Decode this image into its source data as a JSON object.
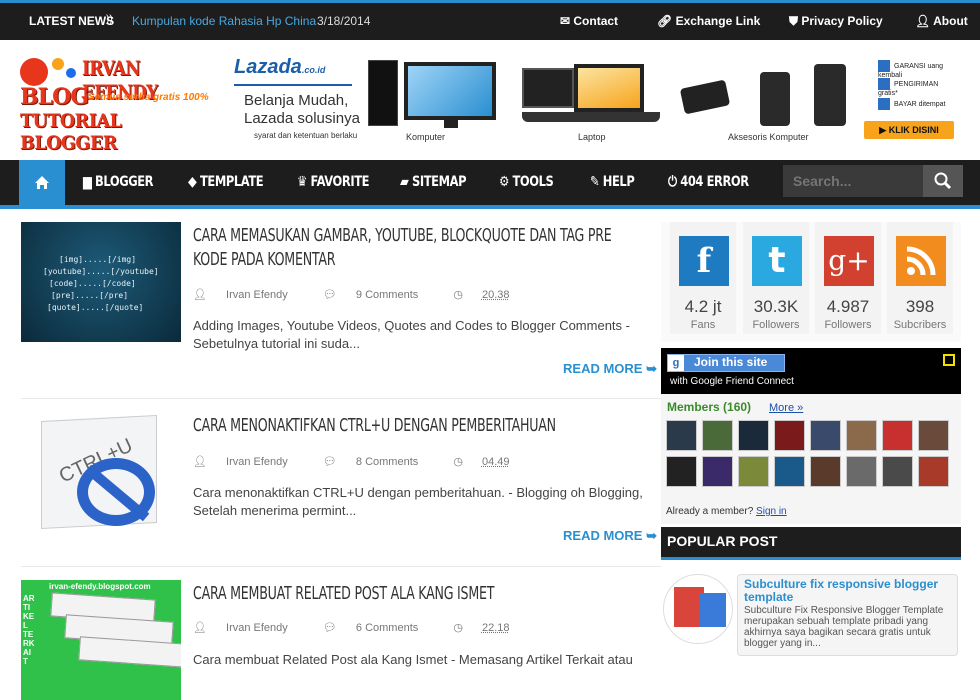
{
  "topbar": {
    "news_label": "LATEST NEWS",
    "news_link": "Kumpulan kode Rahasia Hp China",
    "news_date": "3/18/2014",
    "links": [
      "Contact",
      "Exchange Link",
      "Privacy Policy",
      "About"
    ]
  },
  "header": {
    "logo_line1": "IRVAN EFENDY",
    "logo_line2": "BLOG",
    "logo_tagline": "Semua serba gratis 100%",
    "logo_line3": "TUTORIAL BLOGGER",
    "ad": {
      "brand": "Lazada",
      "brand_suffix": ".co.id",
      "slogan1": "Belanja Mudah,",
      "slogan2": "Lazada solusinya",
      "terms": "syarat dan ketentuan berlaku",
      "labels": [
        "Komputer",
        "Laptop",
        "Aksesoris Komputer"
      ],
      "badges": [
        "GARANSI uang kembali",
        "PENGIRIMAN gratis*",
        "BAYAR ditempat"
      ],
      "cta": "KLIK DISINI"
    }
  },
  "nav": {
    "items": [
      "BLOGGER",
      "TEMPLATE",
      "FAVORITE",
      "SITEMAP",
      "TOOLS",
      "HELP",
      "404 ERROR"
    ],
    "search_placeholder": "Search..."
  },
  "posts": [
    {
      "title": "CARA MEMASUKAN GAMBAR, YOUTUBE, BLOCKQUOTE DAN TAG PRE KODE PADA KOMENTAR",
      "author": "Irvan Efendy",
      "comments": "9 Comments",
      "time": "20.38",
      "snippet": "Adding Images, Youtube Videos, Quotes and Codes to Blogger Comments - Sebetulnya tutorial ini suda...",
      "read_more": "READ MORE",
      "thumb_lines": [
        "[img].....[/img]",
        "[youtube].....[/youtube]",
        "[code].....[/code]",
        "[pre].....[/pre]",
        "[quote].....[/quote]"
      ]
    },
    {
      "title": "CARA MENONAKTIFKAN CTRL+U DENGAN PEMBERITAHUAN",
      "author": "Irvan Efendy",
      "comments": "8 Comments",
      "time": "04.49",
      "snippet": "Cara menonaktifkan CTRL+U dengan pemberitahuan. - Blogging oh Blogging, Setelah menerima permint...",
      "read_more": "READ MORE",
      "thumb_text": "CTRL+U"
    },
    {
      "title": "CARA MEMBUAT RELATED POST ALA KANG ISMET",
      "author": "Irvan Efendy",
      "comments": "6 Comments",
      "time": "22.18",
      "snippet": "Cara membuat Related Post ala Kang Ismet - Memasang Artikel Terkait atau",
      "thumb_text": "irvan-efendy.blogspot.com",
      "thumb_side": "ARTIKEL TERKAIT"
    }
  ],
  "social": [
    {
      "count": "4.2 jt",
      "label": "Fans",
      "icon": "facebook-icon",
      "color": "#1f7bc1"
    },
    {
      "count": "30.3K",
      "label": "Followers",
      "icon": "twitter-icon",
      "color": "#2aa8e0"
    },
    {
      "count": "4.987",
      "label": "Followers",
      "icon": "google-plus-icon",
      "color": "#d2412f"
    },
    {
      "count": "398",
      "label": "Subcribers",
      "icon": "rss-icon",
      "color": "#f28c1e"
    }
  ],
  "gfc": {
    "join": "Join this site",
    "with": "with Google Friend Connect",
    "members": "Members (160)",
    "more": "More »",
    "already": "Already a member?",
    "signin": "Sign in"
  },
  "popular": {
    "heading": "POPULAR POST",
    "title": "Subculture fix responsive blogger template",
    "snippet": "Subculture Fix Responsive Blogger Template merupakan sebuah template pribadi yang akhirnya saya bagikan secara gratis untuk blogger yang in..."
  }
}
